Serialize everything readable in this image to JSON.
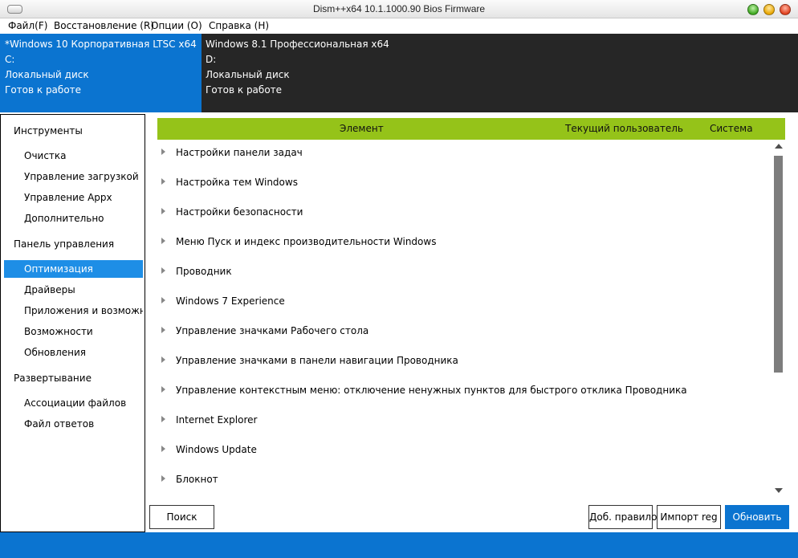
{
  "window": {
    "title": "Dism++x64 10.1.1000.90 Bios Firmware"
  },
  "menu": [
    {
      "label": "Файл(F)"
    },
    {
      "label": "Восстановление (R)"
    },
    {
      "label": "Опции (O)"
    },
    {
      "label": "Справка (H)"
    }
  ],
  "drives": [
    {
      "name": "*Windows 10 Корпоративная LTSC x64",
      "letter": "C:",
      "type": "Локальный диск",
      "status": "Готов к работе",
      "active": true
    },
    {
      "name": "Windows 8.1 Профессиональная x64",
      "letter": "D:",
      "type": "Локальный диск",
      "status": "Готов к работе",
      "active": false
    }
  ],
  "sidebar": {
    "tools": {
      "title": "Инструменты",
      "items": [
        {
          "label": "Очистка"
        },
        {
          "label": "Управление загрузкой"
        },
        {
          "label": "Управление Appx"
        },
        {
          "label": "Дополнительно"
        }
      ]
    },
    "control": {
      "title": "Панель управления",
      "items": [
        {
          "label": "Оптимизация",
          "selected": true
        },
        {
          "label": "Драйверы"
        },
        {
          "label": "Приложения и возможнос"
        },
        {
          "label": "Возможности"
        },
        {
          "label": "Обновления"
        }
      ]
    },
    "deploy": {
      "title": "Развертывание",
      "items": [
        {
          "label": "Ассоциации файлов"
        },
        {
          "label": "Файл ответов"
        }
      ]
    }
  },
  "table": {
    "columns": [
      "Элемент",
      "Текущий пользователь",
      "Система"
    ],
    "rows": [
      "Настройки панели задач",
      "Настройка тем Windows",
      "Настройки безопасности",
      "Меню Пуск и индекс производительности Windows",
      "Проводник",
      "Windows 7 Experience",
      "Управление значками Рабочего стола",
      "Управление значками в панели навигации Проводника",
      "Управление контекстным меню: отключение ненужных пунктов для быстрого отклика Проводника",
      "Internet Explorer",
      "Windows Update",
      "Блокнот"
    ]
  },
  "buttons": {
    "search": "Поиск",
    "add_rule": "Доб. правило",
    "import_reg": "Импорт reg",
    "refresh": "Обновить"
  },
  "colors": {
    "accent": "#0b74d0",
    "header_green": "#95c319",
    "dark_panel": "#262626",
    "selection": "#1e8ee6"
  }
}
